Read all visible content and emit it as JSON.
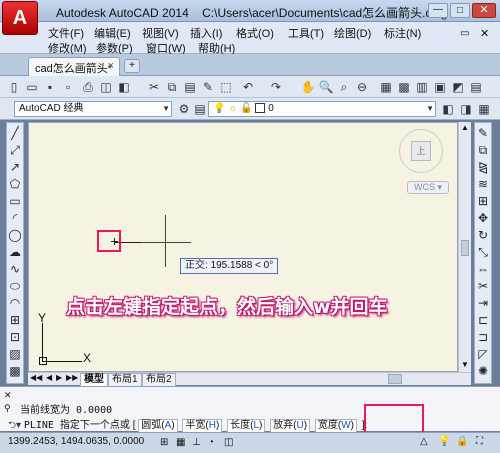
{
  "window": {
    "app_name": "Autodesk AutoCAD 2014",
    "file_path": "C:\\Users\\acer\\Documents\\cad怎么画箭头.dwg",
    "app_button": "A"
  },
  "menu": {
    "row1": [
      "文件(F)",
      "编辑(E)",
      "视图(V)",
      "插入(I)",
      "格式(O)",
      "工具(T)",
      "绘图(D)",
      "标注(N)"
    ],
    "row2": [
      "修改(M)",
      "参数(P)",
      "窗口(W)",
      "帮助(H)"
    ]
  },
  "tabs": {
    "document": "cad怎么画箭头*",
    "close": "×",
    "new_tab": "+"
  },
  "toolbar": {
    "workspace": "AutoCAD 经典",
    "layer_value": "0"
  },
  "drawing": {
    "tooltip_label": "正交:",
    "tooltip_value": "195.1588 < 0°",
    "wcs_label": "WCS",
    "viewcube_label": "上",
    "ucs_x": "X",
    "ucs_y": "Y"
  },
  "layout_tabs": [
    "模型",
    "布局1",
    "布局2"
  ],
  "annotation": "点击左键指定起点，然后输入w并回车",
  "command": {
    "line1": "当前线宽为 0.0000",
    "prompt": "PLINE 指定下一个点或",
    "options": [
      {
        "label": "圆弧(",
        "key": "A",
        "end": ")"
      },
      {
        "label": "半宽(",
        "key": "H",
        "end": ")"
      },
      {
        "label": "长度(",
        "key": "L",
        "end": ")"
      },
      {
        "label": "放弃(",
        "key": "U",
        "end": ")"
      },
      {
        "label": "宽度(",
        "key": "W",
        "end": ")"
      }
    ],
    "tail": "]:"
  },
  "status": {
    "coordinates": "1399.2453, 1494.0635, 0.0000"
  },
  "colors": {
    "highlight": "#e8185a",
    "canvas": "#f7f3e2"
  }
}
